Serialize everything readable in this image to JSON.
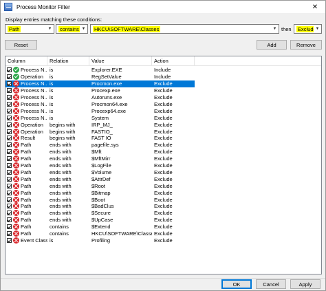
{
  "window": {
    "title": "Process Monitor Filter",
    "controls": {
      "minimize": "—",
      "close": "✕"
    }
  },
  "conditions_label": "Display entries matching these conditions:",
  "filter": {
    "column": "Path",
    "relation": "contains",
    "value": "HKCU\\SOFTWARE\\Classes",
    "then_label": "then",
    "action": "Exclude"
  },
  "buttons": {
    "reset": "Reset",
    "add": "Add",
    "remove": "Remove",
    "ok": "OK",
    "cancel": "Cancel",
    "apply": "Apply"
  },
  "table": {
    "headers": [
      "Column",
      "Relation",
      "Value",
      "Action"
    ],
    "rows": [
      {
        "column": "Process N...",
        "relation": "is",
        "value": "Explorer.EXE",
        "action": "Include",
        "type": "include"
      },
      {
        "column": "Operation",
        "relation": "is",
        "value": "RegSetValue",
        "action": "Include",
        "type": "include"
      },
      {
        "column": "Process N...",
        "relation": "is",
        "value": "Procmon.exe",
        "action": "Exclude",
        "type": "exclude",
        "selected": true
      },
      {
        "column": "Process N...",
        "relation": "is",
        "value": "Procexp.exe",
        "action": "Exclude",
        "type": "exclude"
      },
      {
        "column": "Process N...",
        "relation": "is",
        "value": "Autoruns.exe",
        "action": "Exclude",
        "type": "exclude"
      },
      {
        "column": "Process N...",
        "relation": "is",
        "value": "Procmon64.exe",
        "action": "Exclude",
        "type": "exclude"
      },
      {
        "column": "Process N...",
        "relation": "is",
        "value": "Procexp64.exe",
        "action": "Exclude",
        "type": "exclude"
      },
      {
        "column": "Process N...",
        "relation": "is",
        "value": "System",
        "action": "Exclude",
        "type": "exclude"
      },
      {
        "column": "Operation",
        "relation": "begins with",
        "value": "IRP_MJ_",
        "action": "Exclude",
        "type": "exclude"
      },
      {
        "column": "Operation",
        "relation": "begins with",
        "value": "FASTIO_",
        "action": "Exclude",
        "type": "exclude"
      },
      {
        "column": "Result",
        "relation": "begins with",
        "value": "FAST IO",
        "action": "Exclude",
        "type": "exclude"
      },
      {
        "column": "Path",
        "relation": "ends with",
        "value": "pagefile.sys",
        "action": "Exclude",
        "type": "exclude"
      },
      {
        "column": "Path",
        "relation": "ends with",
        "value": "$Mft",
        "action": "Exclude",
        "type": "exclude"
      },
      {
        "column": "Path",
        "relation": "ends with",
        "value": "$MftMirr",
        "action": "Exclude",
        "type": "exclude"
      },
      {
        "column": "Path",
        "relation": "ends with",
        "value": "$LogFile",
        "action": "Exclude",
        "type": "exclude"
      },
      {
        "column": "Path",
        "relation": "ends with",
        "value": "$Volume",
        "action": "Exclude",
        "type": "exclude"
      },
      {
        "column": "Path",
        "relation": "ends with",
        "value": "$AttrDef",
        "action": "Exclude",
        "type": "exclude"
      },
      {
        "column": "Path",
        "relation": "ends with",
        "value": "$Root",
        "action": "Exclude",
        "type": "exclude"
      },
      {
        "column": "Path",
        "relation": "ends with",
        "value": "$Bitmap",
        "action": "Exclude",
        "type": "exclude"
      },
      {
        "column": "Path",
        "relation": "ends with",
        "value": "$Boot",
        "action": "Exclude",
        "type": "exclude"
      },
      {
        "column": "Path",
        "relation": "ends with",
        "value": "$BadClus",
        "action": "Exclude",
        "type": "exclude"
      },
      {
        "column": "Path",
        "relation": "ends with",
        "value": "$Secure",
        "action": "Exclude",
        "type": "exclude"
      },
      {
        "column": "Path",
        "relation": "ends with",
        "value": "$UpCase",
        "action": "Exclude",
        "type": "exclude"
      },
      {
        "column": "Path",
        "relation": "contains",
        "value": "$Extend",
        "action": "Exclude",
        "type": "exclude"
      },
      {
        "column": "Path",
        "relation": "contains",
        "value": "HKCU\\SOFTWARE\\Classes",
        "action": "Exclude",
        "type": "exclude"
      },
      {
        "column": "Event Class",
        "relation": "is",
        "value": "Profiling",
        "action": "Exclude",
        "type": "exclude"
      }
    ]
  },
  "colors": {
    "selection": "#0078d7",
    "highlight": "#ffff00",
    "include_icon": "#2ea84a",
    "exclude_icon": "#d8262b"
  }
}
